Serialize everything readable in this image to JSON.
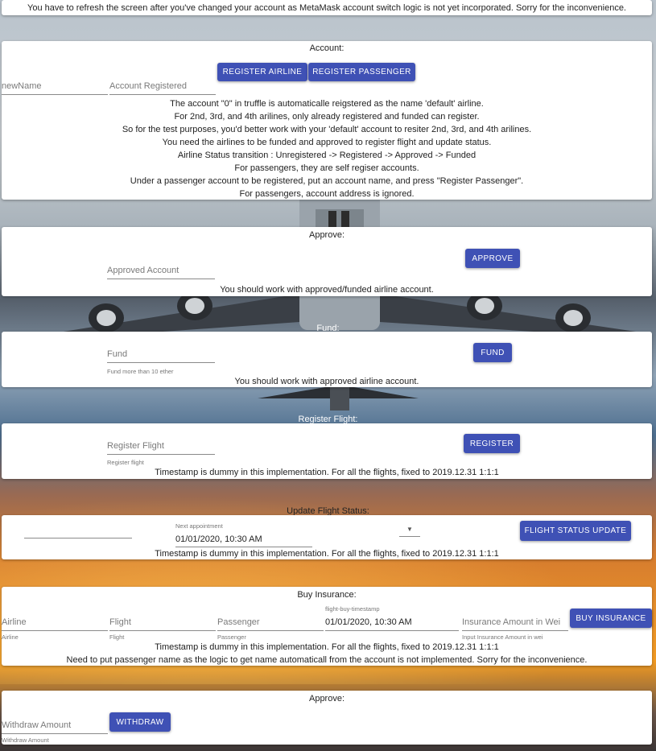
{
  "notice": "You have to refresh the screen after you've changed your account as MetaMask account switch logic is not yet incorporated. Sorry for the inconvenience.",
  "account": {
    "title": "Account:",
    "register_airline": "REGISTER AIRLINE",
    "register_passenger": "REGISTER PASSENGER",
    "name_placeholder": "newName",
    "status": "Account Registered",
    "lines": [
      "The account \"0\" in truffle is automaticalle reigstered as the name 'default' airline.",
      "For 2nd, 3rd, and 4th arilines, only already registered and funded can register.",
      "So for the test purposes, you'd better work with your 'default' account to resiter 2nd, 3rd, and 4th arilines.",
      "You need the airlines to be funded and approved to register flight and update status.",
      "Airline Status transition : Unregistered -> Registered -> Approved -> Funded",
      "For passengers, they are self regiser accounts.",
      "Under a passenger account to be registered, put an account name, and press \"Register Passenger\".",
      "For passengers, account address is ignored."
    ]
  },
  "approve": {
    "title": "Approve:",
    "placeholder": "Approved Account",
    "button": "APPROVE",
    "note": "You should work with approved/funded airline account."
  },
  "fund": {
    "title": "Fund:",
    "placeholder": "Fund",
    "helper": "Fund more than 10 ether",
    "button": "FUND",
    "note": "You should work with approved airline account."
  },
  "register_flight": {
    "title": "Register Flight:",
    "placeholder": "Register Flight",
    "helper": "Register flight",
    "button": "REGISTER",
    "note": "Timestamp is dummy in this implementation. For all the flights, fixed to 2019.12.31 1:1:1"
  },
  "update_status": {
    "title": "Update Flight Status:",
    "appointment_label": "Next appointment",
    "appointment_value": "01/01/2020, 10:30 AM",
    "button": "FLIGHT STATUS UPDATE",
    "note": "Timestamp is dummy in this implementation. For all the flights, fixed to 2019.12.31 1:1:1"
  },
  "insurance": {
    "title": "Buy Insurance:",
    "airline_placeholder": "Airline",
    "airline_helper": "Airline",
    "flight_placeholder": "Flight",
    "flight_helper": "Flight",
    "passenger_placeholder": "Passenger",
    "passenger_helper": "Passenger",
    "timestamp_label": "flight-buy-timestamp",
    "timestamp_value": "01/01/2020, 10:30 AM",
    "amount_placeholder": "Insurance Amount in Wei",
    "amount_helper": "Input Insurance Amount in wei",
    "button": "BUY INSURANCE",
    "note1": "Timestamp is dummy in this implementation. For all the flights, fixed to 2019.12.31 1:1:1",
    "note2": "Need to put passenger name as the logic to get name automaticall from the account is not implemented. Sorry for the inconvenience."
  },
  "withdraw": {
    "title": "Approve:",
    "placeholder": "Withdraw Amount",
    "helper": "Withdraw Amount",
    "button": "WITHDRAW"
  },
  "colors": {
    "primary": "#3f51b5",
    "sunset": "#f19a22"
  }
}
